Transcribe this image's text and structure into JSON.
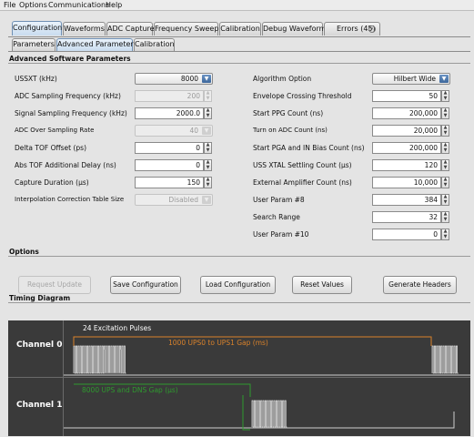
{
  "menu": [
    "File",
    "Options",
    "Communications",
    "Help"
  ],
  "tabs": [
    "Configuration",
    "Waveforms",
    "ADC Capture",
    "Frequency Sweep",
    "Calibration",
    "Debug Waveform",
    "Errors (45)"
  ],
  "subtabs": [
    "Parameters",
    "Advanced Parameters",
    "Calibration"
  ],
  "advanced": {
    "title": "Advanced Software Parameters",
    "left": [
      {
        "label": "USSXT (kHz)",
        "value": "8000",
        "kind": "dropdown"
      },
      {
        "label": "ADC Sampling Frequency (kHz)",
        "value": "200",
        "kind": "field-disabled"
      },
      {
        "label": "Signal Sampling Frequency (kHz)",
        "value": "2000.0",
        "kind": "field"
      },
      {
        "label": "ADC Over Sampling Rate",
        "value": "40",
        "kind": "dropdown-disabled"
      },
      {
        "label": "Delta TOF Offset (ps)",
        "value": "0",
        "kind": "field"
      },
      {
        "label": "Abs TOF Additional Delay (ns)",
        "value": "0",
        "kind": "field"
      },
      {
        "label": "Capture Duration (µs)",
        "value": "150",
        "kind": "field"
      },
      {
        "label": "Interpolation Correction Table Size",
        "value": "Disabled",
        "kind": "dropdown-disabled"
      }
    ],
    "right": [
      {
        "label": "Algorithm Option",
        "value": "Hilbert Wide",
        "kind": "dropdown"
      },
      {
        "label": "Envelope Crossing Threshold",
        "value": "50",
        "kind": "field"
      },
      {
        "label": "Start PPG Count (ns)",
        "value": "200,000",
        "kind": "field"
      },
      {
        "label": "Turn on ADC Count (ns)",
        "value": "20,000",
        "kind": "field"
      },
      {
        "label": "Start PGA and IN Bias Count (ns)",
        "value": "200,000",
        "kind": "field"
      },
      {
        "label": "USS XTAL Settling Count (µs)",
        "value": "120",
        "kind": "field"
      },
      {
        "label": "External Amplifier Count (ns)",
        "value": "10,000",
        "kind": "field"
      },
      {
        "label": "User Param #8",
        "value": "384",
        "kind": "field"
      },
      {
        "label": "Search Range",
        "value": "32",
        "kind": "field"
      },
      {
        "label": "User Param #10",
        "value": "0",
        "kind": "field"
      }
    ]
  },
  "options": {
    "title": "Options",
    "buttons": [
      "Request Update",
      "Save Configuration",
      "Load Configuration",
      "Reset Values",
      "Generate Headers"
    ]
  },
  "timing": {
    "title": "Timing Diagram",
    "channel0": "Channel 0",
    "channel1": "Channel 1",
    "pulses_label": "24 Excitation Pulses",
    "gap_label": "1000 UPS0 to UPS1 Gap (ms)",
    "ups_dns_label": "8000 UPS and DNS Gap (µs)",
    "orange": "#d9822b",
    "green": "#2e9b2e"
  }
}
